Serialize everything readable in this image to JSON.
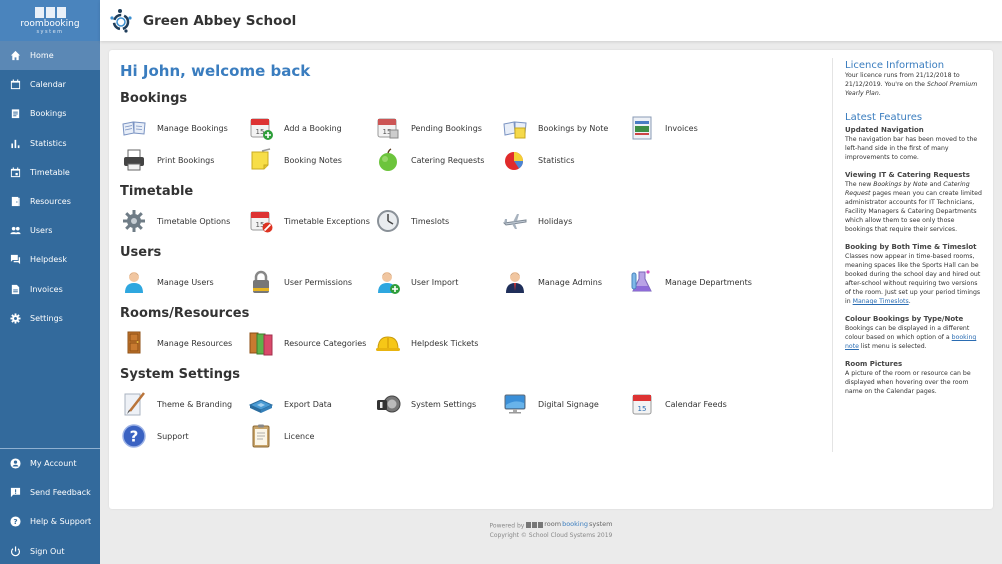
{
  "brand": {
    "name": "roombooking",
    "sub": "system"
  },
  "header": {
    "school_name": "Green Abbey School"
  },
  "sidebar": {
    "items": [
      {
        "label": "Home",
        "icon": "home-icon",
        "active": true
      },
      {
        "label": "Calendar",
        "icon": "calendar-icon"
      },
      {
        "label": "Bookings",
        "icon": "clipboard-icon"
      },
      {
        "label": "Statistics",
        "icon": "bar-chart-icon"
      },
      {
        "label": "Timetable",
        "icon": "calendar-event-icon"
      },
      {
        "label": "Resources",
        "icon": "door-icon"
      },
      {
        "label": "Users",
        "icon": "users-icon"
      },
      {
        "label": "Helpdesk",
        "icon": "chat-icon"
      },
      {
        "label": "Invoices",
        "icon": "document-icon"
      },
      {
        "label": "Settings",
        "icon": "gear-icon"
      }
    ],
    "bottom_items": [
      {
        "label": "My Account",
        "icon": "account-icon"
      },
      {
        "label": "Send Feedback",
        "icon": "feedback-icon"
      },
      {
        "label": "Help & Support",
        "icon": "help-icon"
      },
      {
        "label": "Sign Out",
        "icon": "power-icon"
      }
    ]
  },
  "main": {
    "welcome": "Hi John, welcome back",
    "sections": [
      {
        "title": "Bookings",
        "tiles": [
          {
            "label": "Manage Bookings",
            "icon": "open-book-icon"
          },
          {
            "label": "Add a Booking",
            "icon": "calendar-add-icon"
          },
          {
            "label": "Pending Bookings",
            "icon": "calendar-pending-icon"
          },
          {
            "label": "Bookings by Note",
            "icon": "book-note-icon"
          },
          {
            "label": "Invoices",
            "icon": "invoice-icon"
          },
          {
            "label": "Print Bookings",
            "icon": "printer-icon"
          },
          {
            "label": "Booking Notes",
            "icon": "sticky-note-icon"
          },
          {
            "label": "Catering Requests",
            "icon": "apple-icon"
          },
          {
            "label": "Statistics",
            "icon": "pie-chart-icon"
          }
        ]
      },
      {
        "title": "Timetable",
        "tiles": [
          {
            "label": "Timetable Options",
            "icon": "gear-icon"
          },
          {
            "label": "Timetable Exceptions",
            "icon": "calendar-exception-icon"
          },
          {
            "label": "Timeslots",
            "icon": "clock-icon"
          },
          {
            "label": "Holidays",
            "icon": "airplane-icon"
          }
        ]
      },
      {
        "title": "Users",
        "tiles": [
          {
            "label": "Manage Users",
            "icon": "user-icon"
          },
          {
            "label": "User Permissions",
            "icon": "padlock-icon"
          },
          {
            "label": "User Import",
            "icon": "user-add-icon"
          },
          {
            "label": "Manage Admins",
            "icon": "admin-icon"
          },
          {
            "label": "Manage Departments",
            "icon": "flask-icon"
          }
        ]
      },
      {
        "title": "Rooms/Resources",
        "tiles": [
          {
            "label": "Manage Resources",
            "icon": "door-icon"
          },
          {
            "label": "Resource Categories",
            "icon": "doors-icon"
          },
          {
            "label": "Helpdesk Tickets",
            "icon": "hard-hat-icon"
          }
        ]
      },
      {
        "title": "System Settings",
        "tiles": [
          {
            "label": "Theme & Branding",
            "icon": "paintbrush-icon"
          },
          {
            "label": "Export Data",
            "icon": "export-icon"
          },
          {
            "label": "System Settings",
            "icon": "switch-icon"
          },
          {
            "label": "Digital Signage",
            "icon": "monitor-icon"
          },
          {
            "label": "Calendar Feeds",
            "icon": "calendar-feed-icon"
          },
          {
            "label": "Support",
            "icon": "question-icon"
          },
          {
            "label": "Licence",
            "icon": "clipboard-licence-icon"
          }
        ]
      }
    ]
  },
  "aside": {
    "licence_title": "Licence Information",
    "licence_text_1": "Your licence runs from 21/12/2018 to 21/12/2019. You're on the ",
    "licence_plan": "School Premium Yearly Plan",
    "licence_text_2": ".",
    "features_title": "Latest Features",
    "f1_title": "Updated Navigation",
    "f1_text": "The navigation bar has been moved to the left-hand side in the first of many improvements to come.",
    "f2_title": "Viewing IT & Catering Requests",
    "f2_text_a": "The new ",
    "f2_em1": "Bookings by Note",
    "f2_text_b": " and ",
    "f2_em2": "Catering Request",
    "f2_text_c": " pages mean you can create limited administrator accounts for IT Technicians, Facility Managers & Catering Departments which allow them to see only those bookings that require their services.",
    "f3_title": "Booking by Both Time & Timeslot",
    "f3_text": "Classes now appear in time-based rooms, meaning spaces like the Sports Hall can be booked during the school day and hired out after-school without requiring two versions of the room. Just set up your period timings in ",
    "f3_link": "Manage Timeslots",
    "f3_end": ".",
    "f4_title": "Colour Bookings by Type/Note",
    "f4_text": "Bookings can be displayed in a different colour based on which option of a ",
    "f4_link": "booking note",
    "f4_end": " list menu is selected.",
    "f5_title": "Room Pictures",
    "f5_text": "A picture of the room or resource can be displayed when hovering over the room name on the Calendar pages."
  },
  "footer": {
    "powered_by": "Powered by",
    "rb_room": "room",
    "rb_booking": "booking",
    "rb_system": "system",
    "copyright": "Copyright © School Cloud Systems 2019"
  }
}
